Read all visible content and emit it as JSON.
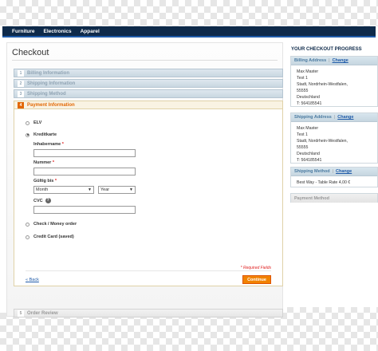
{
  "nav": [
    "Furniture",
    "Electronics",
    "Apparel"
  ],
  "checkout": {
    "title": "Checkout",
    "steps": [
      {
        "num": "1",
        "label": "Billing Information"
      },
      {
        "num": "2",
        "label": "Shipping Information"
      },
      {
        "num": "3",
        "label": "Shipping Method"
      },
      {
        "num": "4",
        "label": "Payment Information"
      },
      {
        "num": "5",
        "label": "Order Review"
      }
    ],
    "payment": {
      "elv": "ELV",
      "kreditkarte": "Kreditkarte",
      "inhabername_label": "Inhabername",
      "nummer_label": "Nummer",
      "gueltig_label": "Gültig bis",
      "month_value": "Month",
      "year_value": "Year",
      "cvc_label": "CVC",
      "help_glyph": "?",
      "required_mark": "*",
      "check_money": "Check / Money order",
      "credit_card_saved": "Credit Card (saved)",
      "required_fields": "* Required Fields",
      "back": "Back",
      "back_icon": "«",
      "continue": "Continue"
    }
  },
  "progress": {
    "title": "YOUR CHECKOUT PROGRESS",
    "separator": "|",
    "change": "Change",
    "billing": {
      "heading": "Billing Address",
      "lines": [
        "Max Master",
        "Test 1",
        "Stadt, Nordrhein-Westfalen,",
        "55555",
        "Deutschland",
        "T: 564185541"
      ]
    },
    "shipping": {
      "heading": "Shipping Address",
      "lines": [
        "Max Master",
        "Test 1",
        "Stadt, Nordrhein-Westfalen,",
        "55555",
        "Deutschland",
        "T: 564185541"
      ]
    },
    "method": {
      "heading": "Shipping Method",
      "line": "Best Way - Table Rate 4,00 €"
    },
    "payment_heading": "Payment Method"
  }
}
